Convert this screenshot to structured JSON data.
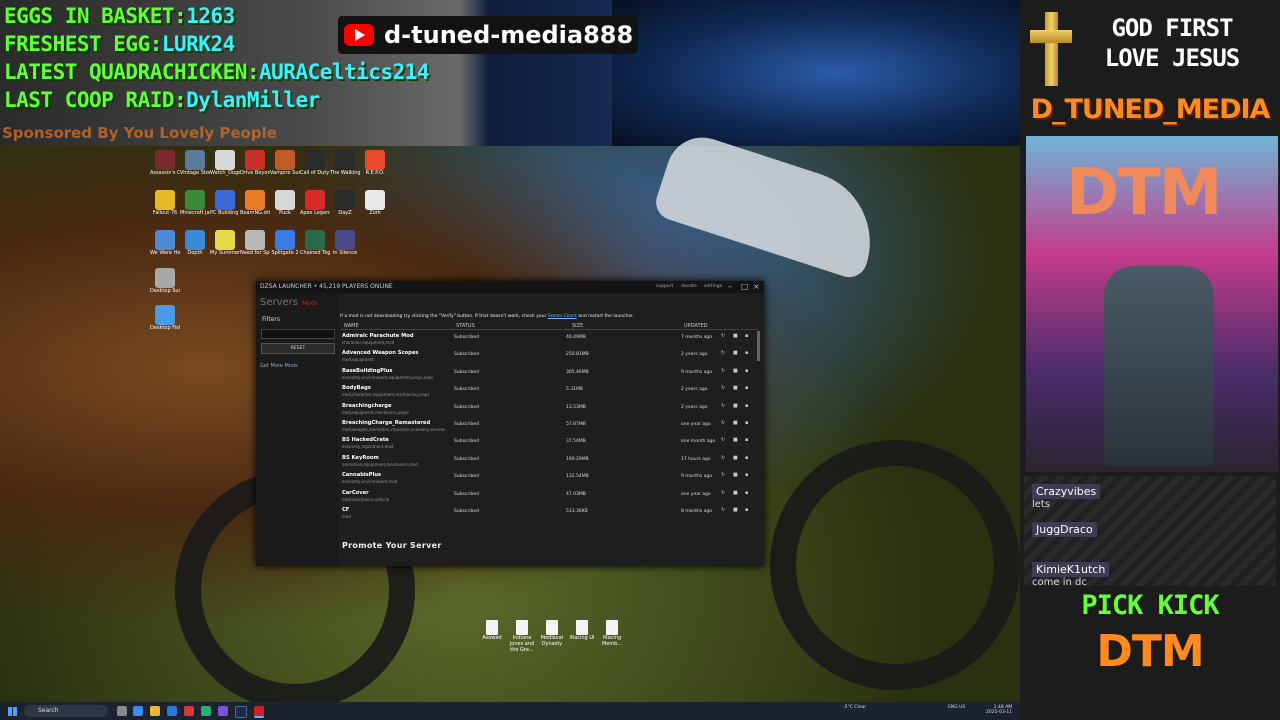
{
  "overlay": {
    "stats": [
      {
        "label": "EGGS IN BASKET:",
        "value": "1263"
      },
      {
        "label": "FRESHEST EGG:",
        "value": "LURK24"
      },
      {
        "label": "LATEST QUADRACHICKEN:",
        "value": "AURACeltics214"
      },
      {
        "label": "LAST COOP RAID:",
        "value": "DylanMiller"
      }
    ],
    "sponsor": "Sponsored By You Lovely People",
    "youtube_channel": "d-tuned-media888"
  },
  "right_panel": {
    "motto_line1": "GOD FIRST",
    "motto_line2": "LOVE JESUS",
    "channel_label": "D_TUNED_MEDIA",
    "webcam_sign": "DTM",
    "chat": [
      {
        "user": "Crazyvibes",
        "msg": "lets"
      },
      {
        "user": "JuggDraco",
        "msg": ""
      },
      {
        "user": "KimieK1utch",
        "msg": "come in dc"
      }
    ],
    "cta_line1": "PICK KICK",
    "cta_line2": "DTM"
  },
  "desktop_icons": [
    "Assassin's Creed V...",
    "Vintage Story",
    "Watch_Dogs 2",
    "Drive Beyond Horizons",
    "Vampire Survivors",
    "Call of Duty®",
    "The Walking Dead The...",
    "R.E.P.O.",
    "Fallout 76",
    "Minecraft Java Edition",
    "PC Building Simulator 2",
    "BeamNG.drive",
    "Puck",
    "Apex Legends",
    "DayZ",
    "Zork",
    "We Were Here Exp...",
    "Depth",
    "My Summer Car",
    "Need for Speed™...",
    "Splitgate 2",
    "Chained Together Complete...",
    "In Silence",
    "Desktop Survivors 98",
    "Desktop Fishing"
  ],
  "launcher": {
    "title": "DZSA LAUNCHER • 45,219 PLAYERS ONLINE",
    "links": [
      "support",
      "donate",
      "settings"
    ],
    "side_title": "Servers",
    "side_sub": "Mods",
    "filters_label": "Filters",
    "reset_label": "RESET",
    "get_more": "Get More Mods",
    "notice": "If a mod is not downloading try clicking the \"Verify\" button. If that doesn't work, check your",
    "notice_link": "Steam Client",
    "notice_tail": "and restart the launcher.",
    "columns": [
      "NAME",
      "STATUS",
      "SIZE",
      "UPDATED"
    ],
    "mods": [
      {
        "name": "Admiralc Parachute Mod",
        "tags": "character,equipment,mod",
        "status": "Subscribed",
        "size": "40.49MB",
        "updated": "7 months ago"
      },
      {
        "name": "Advanced Weapon Scopes",
        "tags": "mod,equipment",
        "status": "Subscribed",
        "size": "250.81MB",
        "updated": "2 years ago"
      },
      {
        "name": "BaseBuildingPlus",
        "tags": "economy,environment,equipment,props,mod",
        "status": "Subscribed",
        "size": "305.46MB",
        "updated": "9 months ago"
      },
      {
        "name": "BodyBags",
        "tags": "mod,character,equipment,mechanics,props",
        "status": "Subscribed",
        "size": "5.31MB",
        "updated": "2 years ago"
      },
      {
        "name": "Breachingcharge",
        "tags": "mod,equipment,mechanics,props",
        "status": "Subscribed",
        "size": "13.53MB",
        "updated": "2 years ago"
      },
      {
        "name": "BreachingCharge_Remastered",
        "tags": "mod,weapon,animation,character,economy,environ",
        "status": "Subscribed",
        "size": "57.87MB",
        "updated": "one year ago"
      },
      {
        "name": "BS HackedCrate",
        "tags": "economy,equipment,mod",
        "status": "Subscribed",
        "size": "37.54MB",
        "updated": "one month ago"
      },
      {
        "name": "BS KeyRoom",
        "tags": "animation,equipment,mechanics,mod",
        "status": "Subscribed",
        "size": "190.29MB",
        "updated": "17 hours ago"
      },
      {
        "name": "CannabisPlus",
        "tags": "economy,environment,mod",
        "status": "Subscribed",
        "size": "132.54MB",
        "updated": "9 months ago"
      },
      {
        "name": "CarCover",
        "tags": "mod,mechanics,vehicle",
        "status": "Subscribed",
        "size": "47.03MB",
        "updated": "one year ago"
      },
      {
        "name": "CF",
        "tags": "mod",
        "status": "Subscribed",
        "size": "513.36KB",
        "updated": "8 months ago"
      }
    ],
    "promote": "Promote Your Server"
  },
  "bottom_icons": [
    "Avowed",
    "Indiana Jones and the Gre...",
    "Medieval Dynasty",
    "iRacing UI",
    "iRacing Memb..."
  ],
  "taskbar": {
    "search_placeholder": "Search",
    "weather": "-2°C Clear",
    "lang": "ENG US",
    "time": "1:48 AM",
    "date": "2025-03-11"
  }
}
